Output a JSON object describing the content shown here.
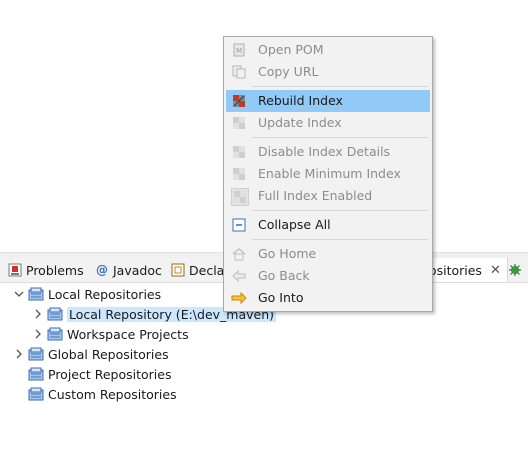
{
  "context_menu": {
    "items": [
      {
        "label": "Open POM",
        "icon": "document-icon",
        "enabled": false
      },
      {
        "label": "Copy URL",
        "icon": "copy-icon",
        "enabled": false
      },
      {
        "label": "Rebuild Index",
        "icon": "rebuild-index-icon",
        "enabled": true,
        "highlighted": true
      },
      {
        "label": "Update Index",
        "icon": "update-index-icon",
        "enabled": false
      },
      {
        "label": "Disable Index Details",
        "icon": "disable-index-icon",
        "enabled": false
      },
      {
        "label": "Enable Minimum Index",
        "icon": "minimum-index-icon",
        "enabled": false
      },
      {
        "label": "Full Index Enabled",
        "icon": "full-index-icon",
        "enabled": false
      },
      {
        "label": "Collapse All",
        "icon": "collapse-all-icon",
        "enabled": true
      },
      {
        "label": "Go Home",
        "icon": "home-icon",
        "enabled": false
      },
      {
        "label": "Go Back",
        "icon": "back-arrow-icon",
        "enabled": false
      },
      {
        "label": "Go Into",
        "icon": "go-into-arrow-icon",
        "enabled": true
      }
    ]
  },
  "tabs": [
    {
      "label": "Problems",
      "icon": "problems-icon"
    },
    {
      "label": "Javadoc",
      "icon": "at-icon"
    },
    {
      "label": "Decla",
      "icon": "declaration-icon"
    },
    {
      "label": "positories",
      "icon": "repositories-icon",
      "active": true
    },
    {
      "label": "",
      "icon": "bug-icon"
    }
  ],
  "tree": [
    {
      "label": "Local Repositories",
      "expanded": true
    },
    {
      "label": "Local Repository (E:\\dev_maven)",
      "selected": true
    },
    {
      "label": "Workspace Projects"
    },
    {
      "label": "Global Repositories",
      "expanded": false
    },
    {
      "label": "Project Repositories"
    },
    {
      "label": "Custom Repositories"
    }
  ],
  "colors": {
    "menu_highlight": "#91c9f7",
    "selection": "#cce8ff",
    "disabled_text": "#8c8c8c",
    "repo_icon": "#3b6fb6"
  }
}
